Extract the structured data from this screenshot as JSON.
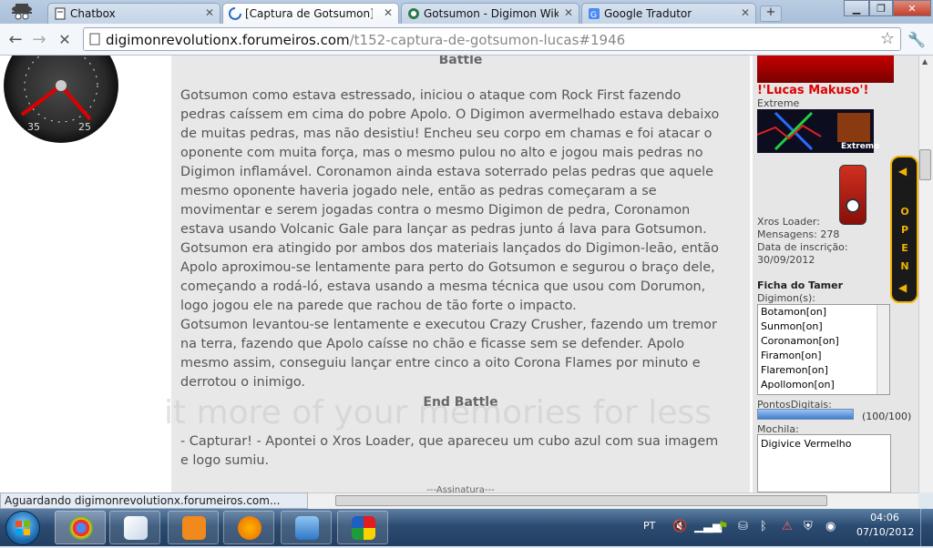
{
  "browser": {
    "tabs": [
      {
        "title": "Chatbox"
      },
      {
        "title": "[Captura de Gotsumon] Lucas"
      },
      {
        "title": "Gotsumon - Digimon Wiki"
      },
      {
        "title": "Google Tradutor"
      }
    ],
    "new_tab": "+",
    "url_host": "digimonrevolutionx.forumeiros.com",
    "url_path": "/t152-captura-de-gotsumon-lucas#1946",
    "status_text": "Aguardando digimonrevolutionx.forumeiros.com..."
  },
  "post": {
    "battle_heading": "Battle",
    "paragraph1": "Gotsumon como estava estressado, iniciou o ataque com Rock First fazendo pedras caíssem em cima do pobre Apolo. O Digimon avermelhado estava debaixo de muitas pedras, mas não desistiu! Encheu seu corpo em chamas e foi atacar o oponente com muita força, mas o mesmo pulou no alto e jogou mais pedras no Digimon inflamável. Coronamon ainda estava soterrado pelas pedras que aquele mesmo oponente haveria jogado nele, então as pedras começaram a se movimentar e serem jogadas contra o mesmo Digimon de pedra, Coronamon estava usando Volcanic Gale para lançar as pedras junto á lava para Gotsumon. Gotsumon era atingido por ambos dos materiais lançados do Digimon-leão, então Apolo aproximou-se lentamente para perto do Gotsumon e segurou o braço dele, começando a rodá-ló, estava usando a mesma técnica que usou com Dorumon, logo jogou ele na parede que rachou de tão forte o impacto.",
    "paragraph2": "Gotsumon levantou-se lentamente e executou Crazy Crusher, fazendo um tremor na terra, fazendo que Apolo caísse no chão e ficasse sem se defender. Apolo mesmo assim, conseguiu lançar entre cinco a oito Corona Flames por minuto e derrotou o inimigo.",
    "end_heading": "End Battle",
    "capture_text": "- Capturar! - Apontei o Xros Loader, que apareceu um cubo azul com sua imagem e logo sumiu.",
    "signature": "---Assinatura---",
    "watermark": "it more of your memories for less"
  },
  "profile": {
    "name": "!'Lucas Makuso'!",
    "rank": "Extreme",
    "banner_caption": "Extremo",
    "device_label": "Xros Loader:",
    "messages": "Mensagens: 278",
    "join_label": "Data de inscrição:",
    "join_date": "30/09/2012",
    "tamer_sheet": "Ficha do Tamer",
    "digimon_label": "Digimon(s):",
    "digimon_list": [
      "Botamon[on]",
      "Sunmon[on]",
      "Coronamon[on]",
      "Firamon[on]",
      "Flaremon[on]",
      "Apollomon[on]"
    ],
    "points_label": "PontosDigitais:",
    "points_value": "(100/100)",
    "points_fraction": 1.0,
    "bag_label": "Mochila:",
    "bag_item": "Digivice Vermelho",
    "open_label": "OPEN"
  },
  "taskbar": {
    "language": "PT",
    "time": "04:06",
    "date": "07/10/2012"
  },
  "colors": {
    "accent_red": "#e00000",
    "open_panel_yellow": "#f2b400",
    "taskbar_blue": "#2c4b70"
  }
}
